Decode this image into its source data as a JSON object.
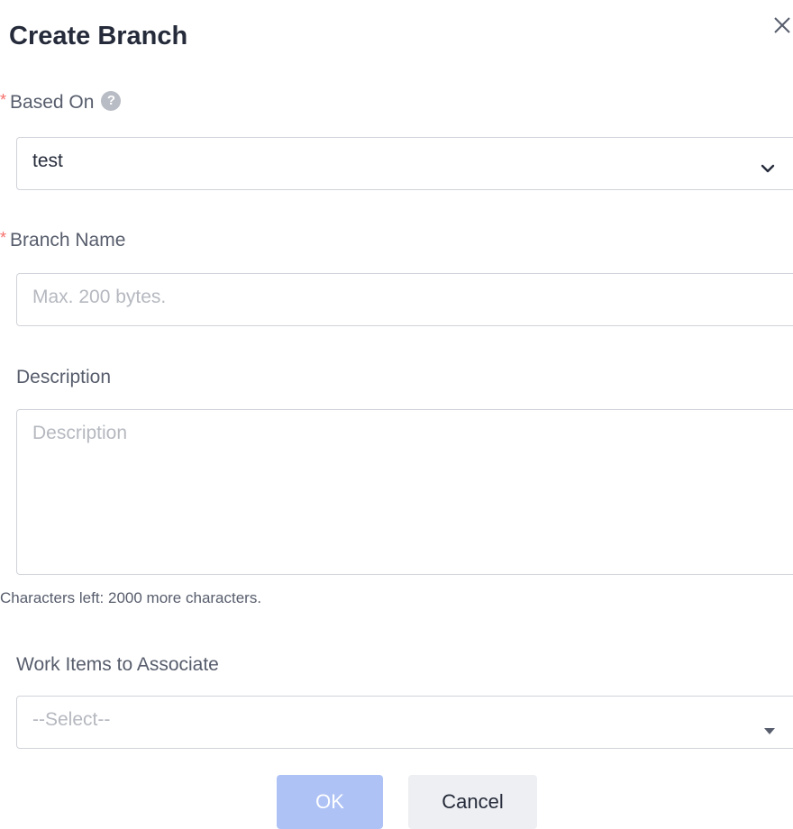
{
  "dialog": {
    "title": "Create Branch",
    "close_icon": "close-icon"
  },
  "based_on": {
    "label": "Based On",
    "required_marker": "*",
    "help_icon": "question-circle-icon",
    "help_glyph": "?",
    "value": "test"
  },
  "branch_name": {
    "label": "Branch Name",
    "required_marker": "*",
    "placeholder": "Max. 200 bytes."
  },
  "description": {
    "label": "Description",
    "placeholder": "Description",
    "counter": "Characters left: 2000 more characters."
  },
  "work_items": {
    "label": "Work Items to Associate",
    "placeholder": "--Select--"
  },
  "buttons": {
    "ok": "OK",
    "cancel": "Cancel"
  },
  "colors": {
    "primary_disabled": "#aec2f5",
    "required": "#f66f6a",
    "cancel_bg": "#eeeff2"
  }
}
